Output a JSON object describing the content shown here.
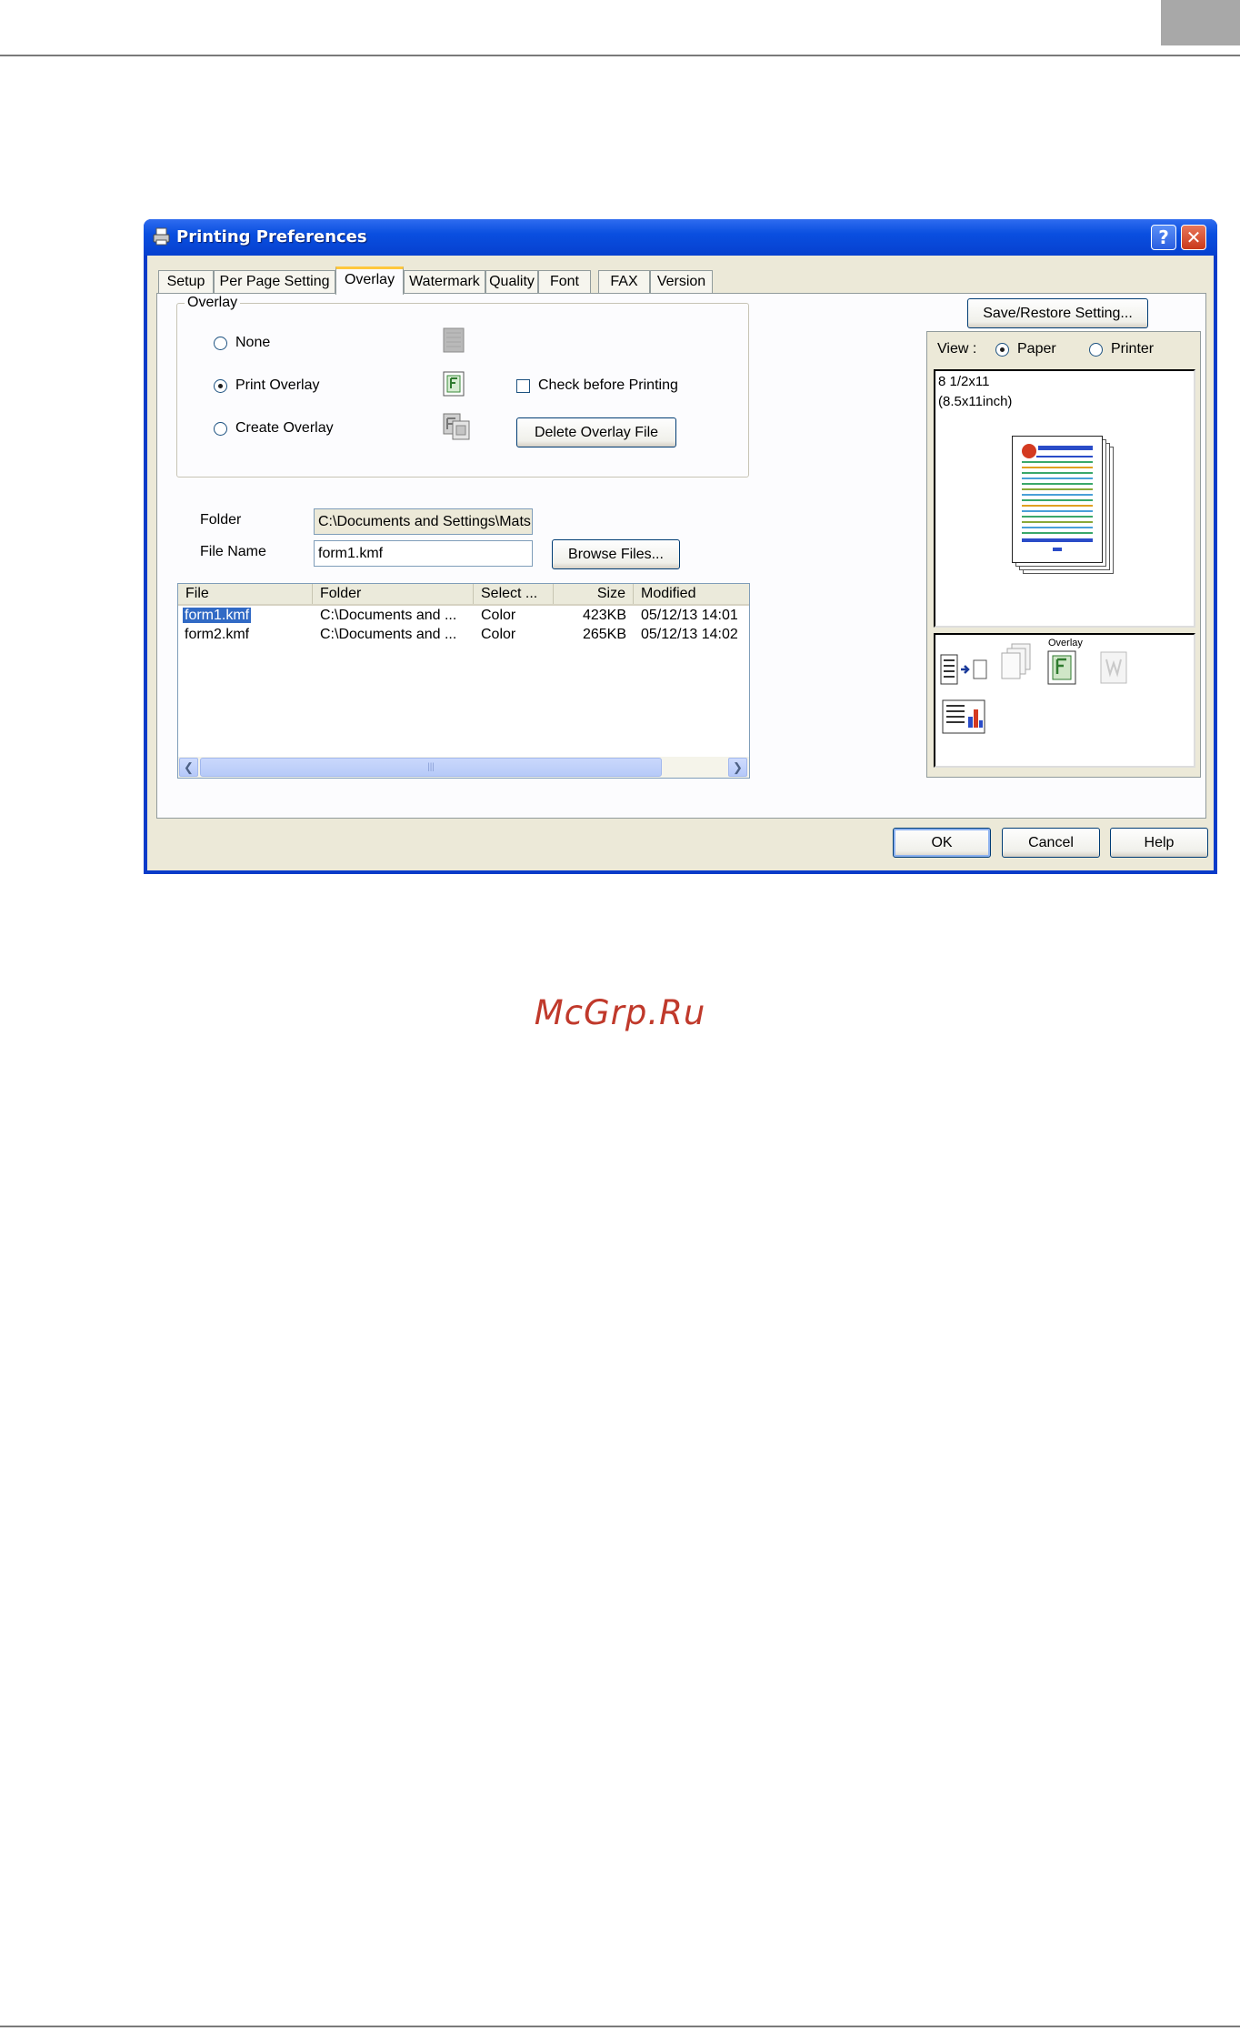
{
  "window": {
    "title": "Printing Preferences",
    "help_glyph": "?",
    "close_glyph": "✕"
  },
  "tabs": [
    {
      "label": "Setup",
      "active": false
    },
    {
      "label": "Per Page Setting",
      "active": false
    },
    {
      "label": "Overlay",
      "active": true
    },
    {
      "label": "Watermark",
      "active": false
    },
    {
      "label": "Quality",
      "active": false
    },
    {
      "label": "Font",
      "active": false
    },
    {
      "label": "FAX",
      "active": false
    },
    {
      "label": "Version",
      "active": false
    }
  ],
  "overlay_group": {
    "title": "Overlay",
    "options": [
      {
        "label": "None",
        "selected": false
      },
      {
        "label": "Print Overlay",
        "selected": true
      },
      {
        "label": "Create Overlay",
        "selected": false
      }
    ],
    "check_before_printing": {
      "label": "Check before Printing",
      "checked": false
    },
    "delete_button": "Delete Overlay File"
  },
  "file_fields": {
    "folder_label": "Folder",
    "folder_value": "C:\\Documents and Settings\\Mats",
    "file_name_label": "File Name",
    "file_name_value": "form1.kmf",
    "browse_button": "Browse Files..."
  },
  "file_list": {
    "columns": [
      "File",
      "Folder",
      "Select ...",
      "Size",
      "Modified"
    ],
    "rows": [
      {
        "file": "form1.kmf",
        "folder": "C:\\Documents and ...",
        "select": "Color",
        "size": "423KB",
        "modified": "05/12/13 14:01",
        "selected": true
      },
      {
        "file": "form2.kmf",
        "folder": "C:\\Documents and ...",
        "select": "Color",
        "size": "265KB",
        "modified": "05/12/13 14:02",
        "selected": false
      }
    ],
    "scroll_left": "❮",
    "scroll_right": "❯",
    "scroll_grip": "|||"
  },
  "preview": {
    "save_restore_button": "Save/Restore Setting...",
    "view_label": "View :",
    "view_paper": {
      "label": "Paper",
      "selected": true
    },
    "view_printer": {
      "label": "Printer",
      "selected": false
    },
    "paper_size": "8 1/2x11",
    "paper_size_inch": "(8.5x11inch)",
    "overlay_icon_label": "Overlay",
    "icons": [
      "duplex-to-single-icon",
      "pages-stack-icon",
      "overlay-form-icon",
      "watermark-icon",
      "chart-page-icon"
    ]
  },
  "footer_buttons": {
    "ok": "OK",
    "cancel": "Cancel",
    "help": "Help"
  },
  "page_watermark": "McGrp.Ru",
  "colors": {
    "title_bar": "#0a4fe0",
    "dialog_face": "#ece9d8",
    "selection": "#316ac5",
    "active_tab_accent": "#ffc83c",
    "watermark": "#c0392b"
  }
}
